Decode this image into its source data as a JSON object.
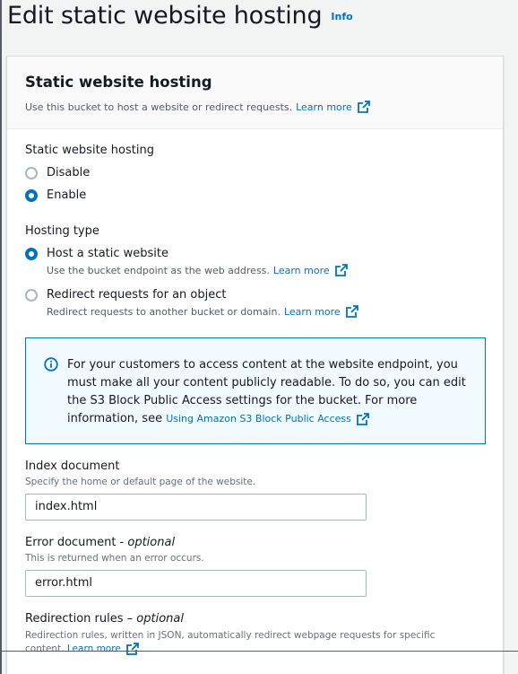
{
  "page": {
    "title": "Edit static website hosting",
    "info_label": "Info"
  },
  "panel": {
    "title": "Static website hosting",
    "description": "Use this bucket to host a website or redirect requests.",
    "learn_more": "Learn more"
  },
  "hosting": {
    "label": "Static website hosting",
    "options": [
      {
        "label": "Disable",
        "checked": false
      },
      {
        "label": "Enable",
        "checked": true
      }
    ]
  },
  "hosting_type": {
    "label": "Hosting type",
    "options": [
      {
        "label": "Host a static website",
        "description": "Use the bucket endpoint as the web address.",
        "learn_more": "Learn more",
        "checked": true
      },
      {
        "label": "Redirect requests for an object",
        "description": "Redirect requests to another bucket or domain.",
        "learn_more": "Learn more",
        "checked": false
      }
    ]
  },
  "alert": {
    "text": "For your customers to access content at the website endpoint, you must make all your content publicly readable. To do so, you can edit the S3 Block Public Access settings for the bucket. For more information, see ",
    "link": "Using Amazon S3 Block Public Access"
  },
  "index_document": {
    "label": "Index document",
    "description": "Specify the home or default page of the website.",
    "value": "index.html"
  },
  "error_document": {
    "label": "Error document - ",
    "optional": "optional",
    "description": "This is returned when an error occurs.",
    "value": "error.html"
  },
  "redirection_rules": {
    "label": "Redirection rules – ",
    "optional": "optional",
    "description": "Redirection rules, written in JSON, automatically redirect webpage requests for specific content. ",
    "learn_more": "Learn more"
  },
  "colors": {
    "link": "#0073bb",
    "text": "#16191f",
    "muted": "#545b64",
    "alert_bg": "#f1faff"
  }
}
